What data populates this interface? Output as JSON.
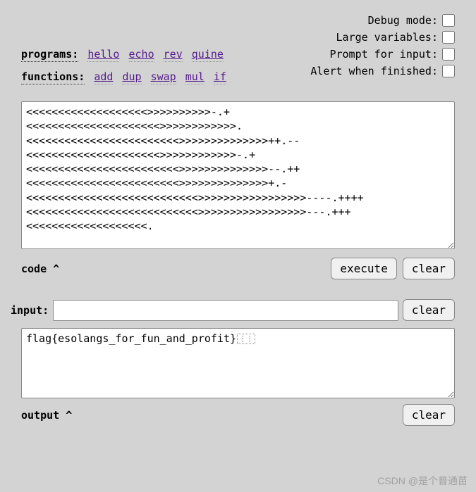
{
  "programs": {
    "label": "programs:",
    "links": [
      "hello",
      "echo",
      "rev",
      "quine"
    ]
  },
  "functions": {
    "label": "functions:",
    "links": [
      "add",
      "dup",
      "swap",
      "mul",
      "if"
    ]
  },
  "options": {
    "debug": {
      "label": "Debug mode:",
      "checked": false
    },
    "large": {
      "label": "Large variables:",
      "checked": false
    },
    "prompt": {
      "label": "Prompt for input:",
      "checked": false
    },
    "alert": {
      "label": "Alert when finished:",
      "checked": false
    }
  },
  "code": {
    "value": "<<<<<<<<<<<<<<<<<<<>>>>>>>>>>-.+\n<<<<<<<<<<<<<<<<<<<<<>>>>>>>>>>>>.\n<<<<<<<<<<<<<<<<<<<<<<<<>>>>>>>>>>>>>>++.--\n<<<<<<<<<<<<<<<<<<<<<>>>>>>>>>>>>-.+\n<<<<<<<<<<<<<<<<<<<<<<<<>>>>>>>>>>>>>>--.++\n<<<<<<<<<<<<<<<<<<<<<<<<>>>>>>>>>>>>>>+.-\n<<<<<<<<<<<<<<<<<<<<<<<<<<<>>>>>>>>>>>>>>>>>----.++++\n<<<<<<<<<<<<<<<<<<<<<<<<<<<>>>>>>>>>>>>>>>>>---.+++\n<<<<<<<<<<<<<<<<<<<.",
    "section_label": "code ^",
    "execute_label": "execute",
    "clear_label": "clear"
  },
  "input": {
    "label": "input:",
    "value": "",
    "clear_label": "clear"
  },
  "output": {
    "value": "flag{esolangs_for_fun_and_profit}",
    "section_label": "output ^",
    "clear_label": "clear"
  },
  "watermark": "CSDN @是个普通苗"
}
